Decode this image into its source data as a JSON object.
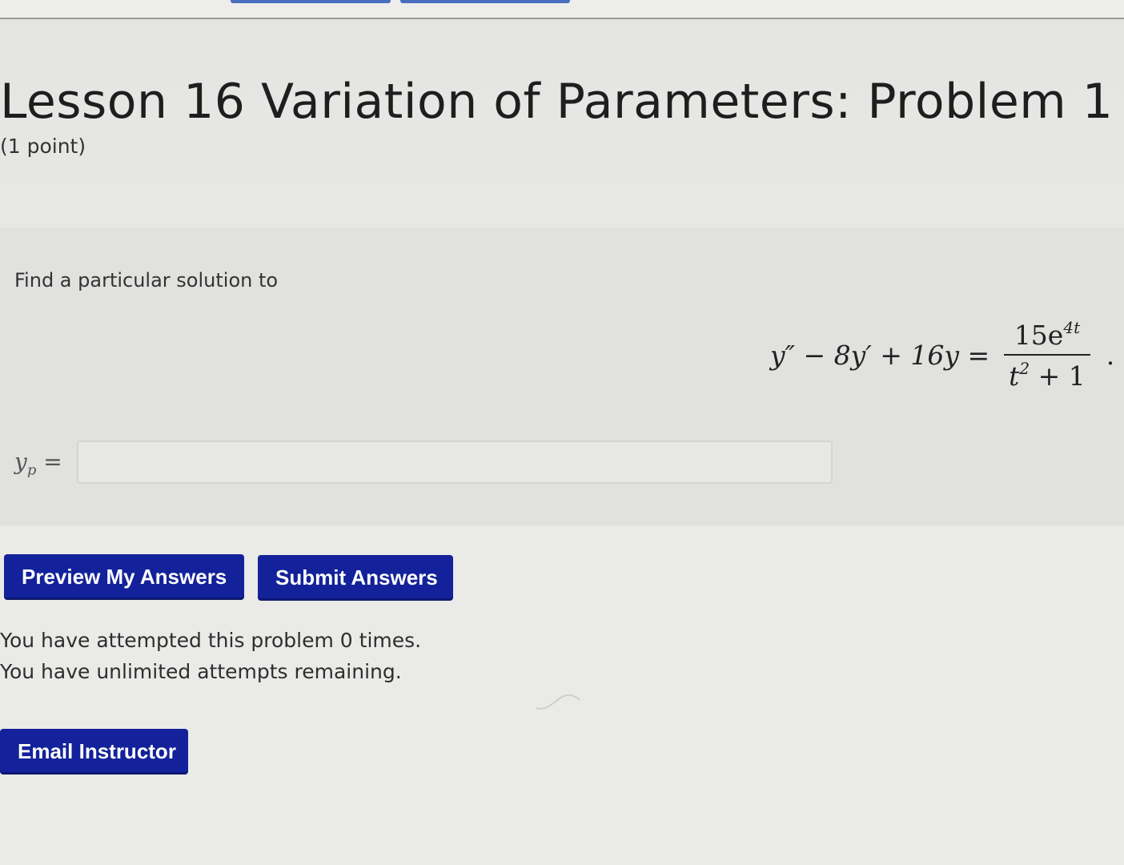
{
  "problem": {
    "title": "Lesson 16 Variation of Parameters: Problem 1",
    "points": "(1 point)",
    "prompt": "Find a particular solution to",
    "equation": {
      "lhs": "y″ − 8y′ + 16y =",
      "numerator_base": "15e",
      "numerator_exponent": "4t",
      "denominator_base": "t",
      "denominator_exponent": "2",
      "denominator_rest": " + 1",
      "terminator": "."
    },
    "answer": {
      "label_base": "y",
      "label_sub": "p",
      "label_eq": " =",
      "value": "",
      "placeholder": ""
    }
  },
  "buttons": {
    "preview_label": "Preview My Answers",
    "submit_label": "Submit Answers",
    "email_label": "Email Instructor"
  },
  "status": {
    "attempted": "You have attempted this problem 0 times.",
    "remaining": "You have unlimited attempts remaining."
  },
  "colors": {
    "button_bg": "#13229a",
    "button_text": "#ffffff",
    "top_tab_accent": "#4a6fc0"
  }
}
